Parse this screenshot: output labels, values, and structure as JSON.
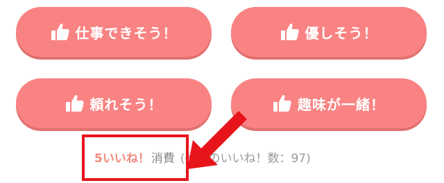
{
  "buttons": [
    {
      "label": "仕事できそう！",
      "icon": "thumbs-up-icon"
    },
    {
      "label": "優しそう！",
      "icon": "thumbs-up-icon"
    },
    {
      "label": "頼れそう！",
      "icon": "thumbs-up-icon"
    },
    {
      "label": "趣味が一緒！",
      "icon": "thumbs-up-icon"
    }
  ],
  "consumption": {
    "amount": "5いいね！",
    "word": "消費",
    "remaining_text": "(残りのいいね！数：97)"
  },
  "annotation": {
    "arrow_color": "#e8141c",
    "box_color": "#e8141c"
  },
  "colors": {
    "button_bg": "#f98383",
    "button_text": "#ffffff",
    "accent_pink": "#f28a7c"
  }
}
